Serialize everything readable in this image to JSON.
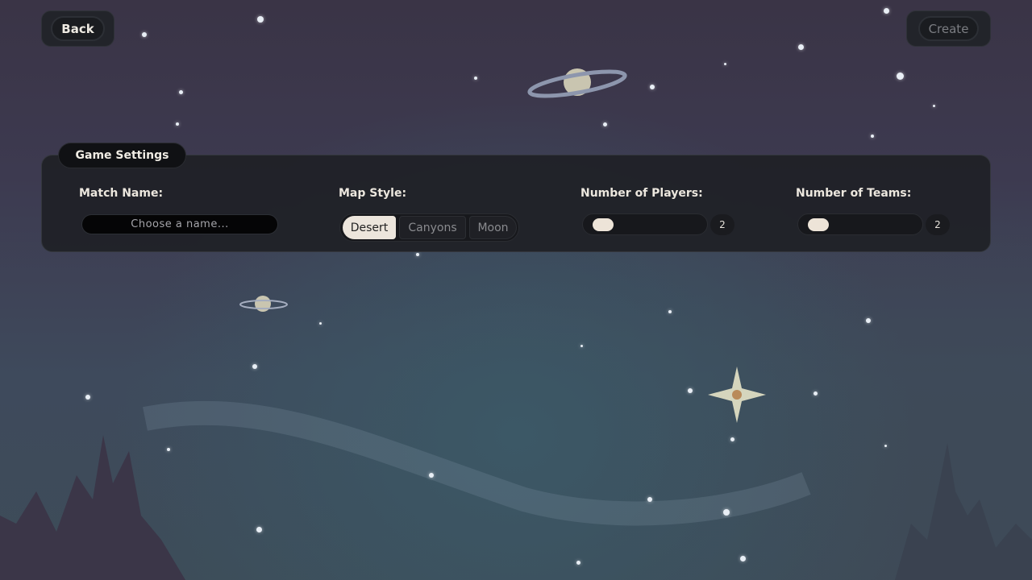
{
  "header": {
    "back_label": "Back",
    "create_label": "Create"
  },
  "panel": {
    "title": "Game Settings",
    "match_name": {
      "label": "Match Name:",
      "placeholder": "Choose a name...",
      "value": ""
    },
    "map_style": {
      "label": "Map Style:",
      "options": [
        "Desert",
        "Canyons",
        "Moon"
      ],
      "selected": "Desert"
    },
    "players": {
      "label": "Number of Players:",
      "value": "2"
    },
    "teams": {
      "label": "Number of Teams:",
      "value": "2"
    }
  },
  "colors": {
    "accent_light": "#ede4d8",
    "panel_bg": "#202126",
    "text_light": "#ece7de",
    "muted_text": "#8a8b8f"
  }
}
